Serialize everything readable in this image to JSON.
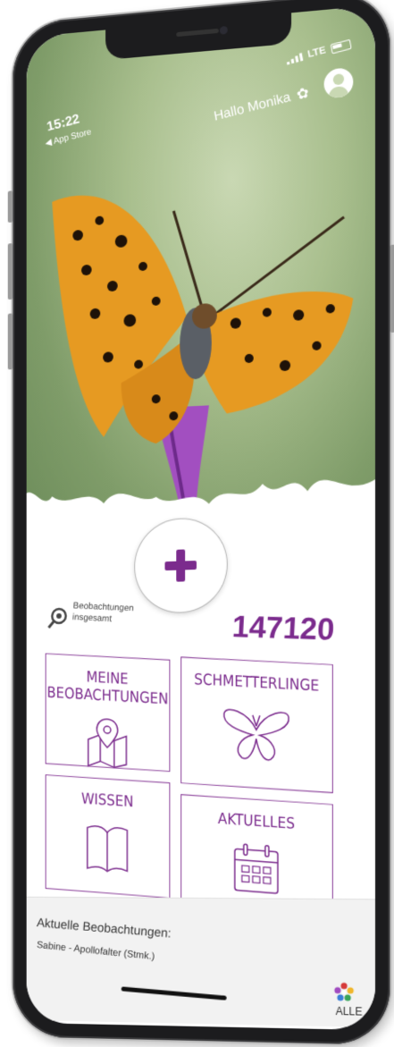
{
  "status_bar": {
    "time": "15:22",
    "back_label": "◀ App Store",
    "network": "LTE"
  },
  "header": {
    "greeting": "Hallo Monika"
  },
  "stats": {
    "label_line1": "Beobachtungen",
    "label_line2": "insgesamt",
    "count": "147120"
  },
  "tiles": [
    {
      "label": "MEINE BEOBACHTUNGEN",
      "icon": "map-pin-icon"
    },
    {
      "label": "SCHMETTERLINGE",
      "icon": "butterfly-icon"
    },
    {
      "label": "WISSEN",
      "icon": "book-icon"
    },
    {
      "label": "AKTUELLES",
      "icon": "calendar-icon"
    }
  ],
  "recent": {
    "title": "Aktuelle Beobachtungen:",
    "item": "Sabine - Apollofalter (Stmk.)"
  },
  "filter": {
    "label": "ALLE"
  },
  "colors": {
    "accent": "#7b2b8d",
    "background": "#ffffff",
    "hero_green": "#a9bf8e"
  }
}
